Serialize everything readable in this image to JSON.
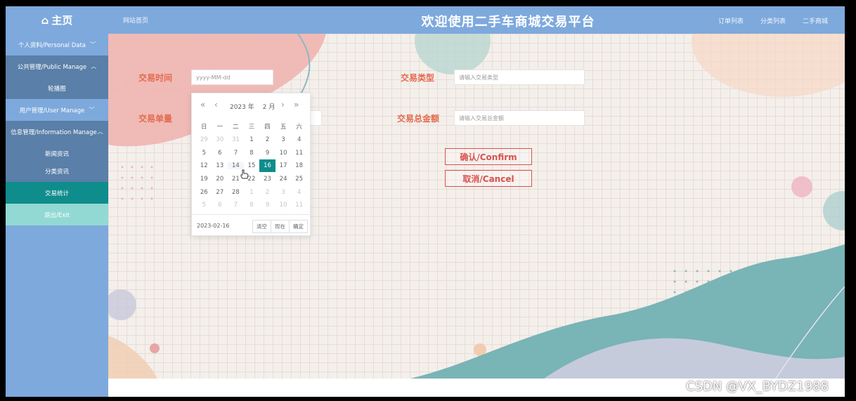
{
  "header": {
    "brand": "主页",
    "brand_icon": "home-icon",
    "site_link": "网站首页",
    "title": "欢迎使用二手车商城交易平台",
    "links": [
      "订单列表",
      "分类列表",
      "二手商城"
    ]
  },
  "sidebar": {
    "personal": "个人资料/Personal Data",
    "public_manage": "公共管理/Public Manage",
    "carousel": "轮播图",
    "user_manage": "用户管理/User Manage",
    "info_manage": "信息管理/Information Manage",
    "news": "新闻资讯",
    "category_news": "分类资讯",
    "trade_stats": "交易统计",
    "exit": "退出/Exit"
  },
  "form": {
    "trade_time_label": "交易时间",
    "trade_time_placeholder": "yyyy-MM-dd",
    "trade_type_label": "交易类型",
    "trade_type_placeholder": "请输入交易类型",
    "trade_qty_label": "交易单量",
    "trade_total_label": "交易总金额",
    "trade_total_placeholder": "请输入交易总金额",
    "confirm": "确认/Confirm",
    "cancel": "取消/Cancel"
  },
  "datepicker": {
    "year": "2023 年",
    "month": "2 月",
    "weekdays": [
      "日",
      "一",
      "二",
      "三",
      "四",
      "五",
      "六"
    ],
    "weeks": [
      [
        "29",
        "30",
        "31",
        "1",
        "2",
        "3",
        "4"
      ],
      [
        "5",
        "6",
        "7",
        "8",
        "9",
        "10",
        "11"
      ],
      [
        "12",
        "13",
        "14",
        "15",
        "16",
        "17",
        "18"
      ],
      [
        "19",
        "20",
        "21",
        "22",
        "23",
        "24",
        "25"
      ],
      [
        "26",
        "27",
        "28",
        "1",
        "2",
        "3",
        "4"
      ],
      [
        "5",
        "6",
        "7",
        "8",
        "9",
        "10",
        "11"
      ]
    ],
    "selected": "16",
    "hovered": "14",
    "current_value": "2023-02-16",
    "clear": "清空",
    "now": "现在",
    "ok": "确定"
  },
  "watermark": "CSDN @VX_BYDZ1988",
  "colors": {
    "header": "#7ea9dc",
    "active_teal": "#0f8c8c",
    "label_orange": "#e36b4f",
    "button_red": "#d9514e"
  }
}
